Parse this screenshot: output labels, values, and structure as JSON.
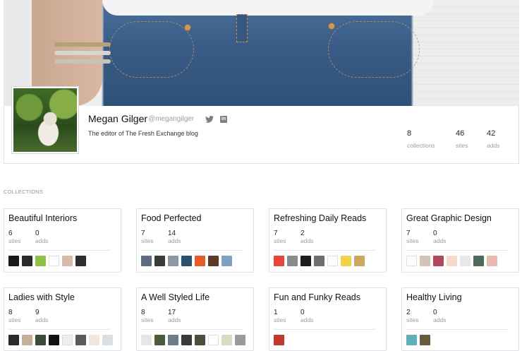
{
  "profile": {
    "name": "Megan Gilger",
    "handle": "@megangilger",
    "bio": "The editor of The Fresh Exchange blog",
    "stats": [
      {
        "value": "8",
        "label": "collections"
      },
      {
        "value": "46",
        "label": "sites"
      },
      {
        "value": "42",
        "label": "adds"
      }
    ]
  },
  "section_title": "COLLECTIONS",
  "collections": [
    {
      "title": "Beautiful Interiors",
      "sites": "6",
      "adds": "0",
      "sites_label": "sites",
      "adds_label": "adds",
      "icons": [
        "#1a1a1a",
        "#2b2b2b",
        "#8bc34a",
        "#ffffff",
        "#d9b9a8",
        "#2d2d2d"
      ]
    },
    {
      "title": "Food Perfected",
      "sites": "7",
      "adds": "14",
      "sites_label": "sites",
      "adds_label": "adds",
      "icons": [
        "#5d6b7a",
        "#3a3a3a",
        "#8c98a8",
        "#2f4f6f",
        "#e65a2c",
        "#5a3b2a",
        "#7fa0c0"
      ]
    },
    {
      "title": "Refreshing Daily Reads",
      "sites": "7",
      "adds": "2",
      "sites_label": "sites",
      "adds_label": "adds",
      "icons": [
        "#e8453c",
        "#8a8a8a",
        "#1d1d1d",
        "#6e6e6e",
        "#ffffff",
        "#f2d24b",
        "#c9a864"
      ]
    },
    {
      "title": "Great Graphic Design",
      "sites": "7",
      "adds": "0",
      "sites_label": "sites",
      "adds_label": "adds",
      "icons": [
        "#ffffff",
        "#d8c2b6",
        "#b04a5a",
        "#f6d9c6",
        "#e8e8e8",
        "#4d6a5a",
        "#e9b9b0"
      ]
    },
    {
      "title": "Ladies with Style",
      "sites": "8",
      "adds": "9",
      "sites_label": "sites",
      "adds_label": "adds",
      "icons": [
        "#2a2a2a",
        "#c7b09a",
        "#3b4a3a",
        "#111111",
        "#eeeeee",
        "#5a5a5a",
        "#efe6e0",
        "#d9dfe3"
      ]
    },
    {
      "title": "A Well Styled Life",
      "sites": "8",
      "adds": "17",
      "sites_label": "sites",
      "adds_label": "adds",
      "icons": [
        "#e6e6e6",
        "#4a5a3a",
        "#6b7c8a",
        "#3a3a3a",
        "#4e4e3a",
        "#ffffff",
        "#dcd8c8",
        "#9a9a9a"
      ]
    },
    {
      "title": "Fun and Funky Reads",
      "sites": "1",
      "adds": "0",
      "sites_label": "sites",
      "adds_label": "adds",
      "icons": [
        "#c0392b"
      ]
    },
    {
      "title": "Healthy Living",
      "sites": "2",
      "adds": "0",
      "sites_label": "sites",
      "adds_label": "adds",
      "icons": [
        "#5fb0b8",
        "#6a5a3a"
      ]
    }
  ]
}
